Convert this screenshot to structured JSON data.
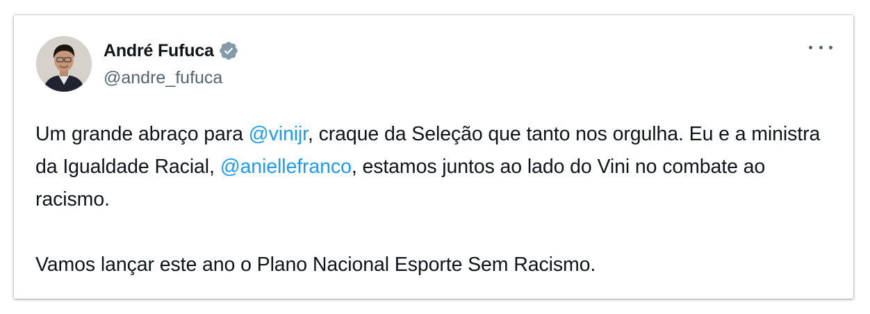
{
  "author": {
    "display_name": "André Fufuca",
    "handle": "@andre_fufuca",
    "verified_icon": "verified-badge-icon",
    "verified_color": "#829aab"
  },
  "more_icon": "more-options-icon",
  "tweet": {
    "paragraph1": {
      "text1": "Um grande abraço para ",
      "mention1": "@vinijr",
      "text2": ", craque da Seleção que tanto nos orgulha. Eu e a ministra da Igualdade Racial, ",
      "mention2": "@aniellefranco",
      "text3": ", estamos juntos ao lado do Vini no combate ao racismo."
    },
    "paragraph2": "Vamos lançar este ano o Plano Nacional Esporte Sem Racismo."
  },
  "colors": {
    "text": "#0f1419",
    "secondary": "#536471",
    "link": "#1d9bf0"
  }
}
